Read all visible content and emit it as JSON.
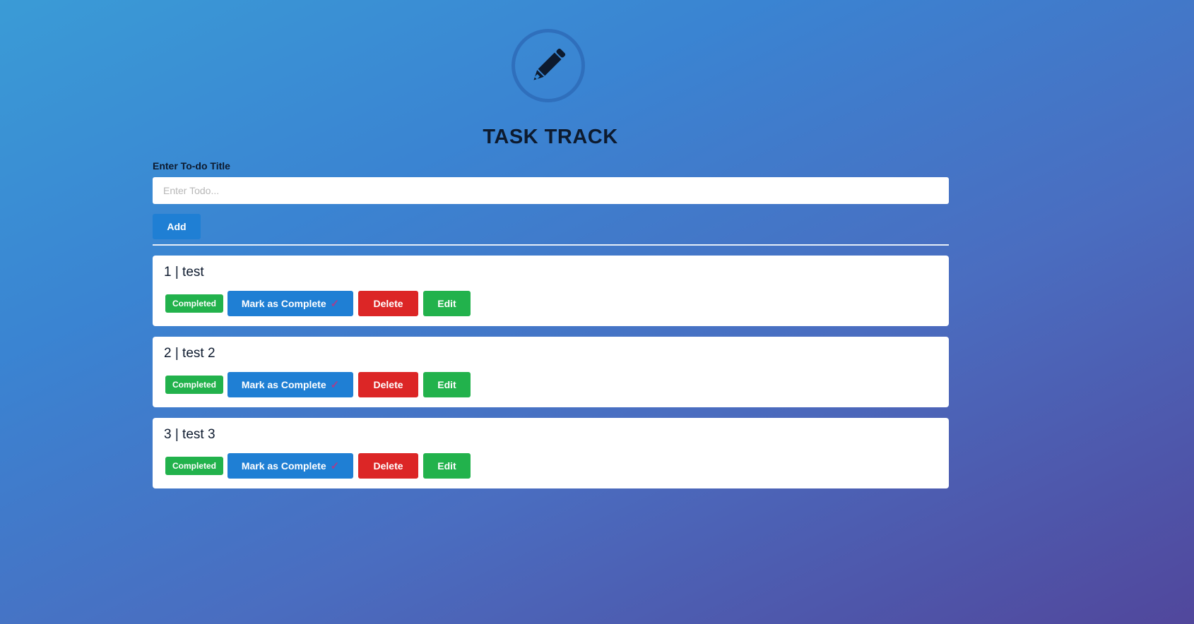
{
  "app": {
    "title": "TASK TRACK",
    "logo_icon": "pencil-icon"
  },
  "form": {
    "label": "Enter To-do Title",
    "input_value": "",
    "input_placeholder": "Enter Todo...",
    "add_label": "Add"
  },
  "todos": [
    {
      "title": "1 | test",
      "status": "Completed",
      "complete_label": "Mark as Complete",
      "complete_icon": "✓",
      "delete_label": "Delete",
      "edit_label": "Edit"
    },
    {
      "title": "2 | test 2",
      "status": "Completed",
      "complete_label": "Mark as Complete",
      "complete_icon": "✓",
      "delete_label": "Delete",
      "edit_label": "Edit"
    },
    {
      "title": "3 | test 3",
      "status": "Completed",
      "complete_label": "Mark as Complete",
      "complete_icon": "✓",
      "delete_label": "Delete",
      "edit_label": "Edit"
    }
  ],
  "colors": {
    "primary": "#1f7fd4",
    "success": "#22b24c",
    "danger": "#dc2626",
    "check": "#a63f8e"
  }
}
